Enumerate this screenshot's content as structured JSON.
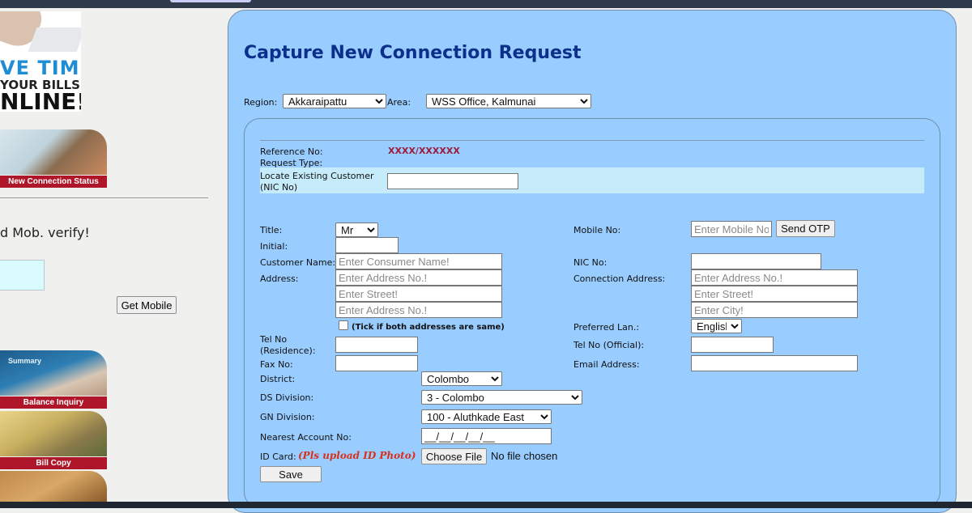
{
  "sidebar": {
    "banner": {
      "line1": "VE TIME",
      "line2": "YOUR BILLS",
      "line3": "NLINE!"
    },
    "tiles": [
      {
        "label": "New Connection Status"
      },
      {
        "label": "Balance Inquiry",
        "sub": "Summary"
      },
      {
        "label": "Bill Copy"
      }
    ],
    "mob_verify_text": "d Mob. verify!",
    "get_mobile_button": "Get Mobile"
  },
  "page": {
    "title": "Capture New Connection Request"
  },
  "filters": {
    "region_label": "Region:",
    "region_value": "Akkaraipattu",
    "area_label": "Area:",
    "area_value": "WSS Office, Kalmunai"
  },
  "form": {
    "reference_label": "Reference No:",
    "reference_value": "XXXX/XXXXXX",
    "request_type_label": "Request Type:",
    "locate_label": "Locate Existing Customer (NIC No)",
    "title_label": "Title:",
    "title_value": "Mr",
    "initial_label": "Initial:",
    "customer_name_label": "Customer Name:",
    "customer_name_placeholder": "Enter Consumer Name!",
    "address_label": "Address:",
    "address_no_placeholder": "Enter Address No.!",
    "address_street_placeholder": "Enter Street!",
    "address_city_placeholder": "Enter Address No.!",
    "same_address_note": "(Tick if both addresses are same)",
    "tel_res_label": "Tel No (Residence):",
    "fax_label": "Fax No:",
    "district_label": "District:",
    "district_value": "Colombo",
    "ds_label": "DS Division:",
    "ds_value": "3 - Colombo",
    "gn_label": "GN Division:",
    "gn_value": "100 - Aluthkade East",
    "nearest_label": "Nearest Account No:",
    "nearest_value": "__/__/__/__/__",
    "idcard_label": "ID Card:",
    "idcard_note": "(Pls upload ID Photo)",
    "choose_file": "Choose File",
    "no_file": "No file chosen",
    "save": "Save",
    "mobile_label": "Mobile No:",
    "mobile_placeholder": "Enter Mobile No",
    "send_otp": "Send OTP",
    "nic_label": "NIC No:",
    "conn_address_label": "Connection Address:",
    "conn_no_placeholder": "Enter Address No.!",
    "conn_street_placeholder": "Enter Street!",
    "conn_city_placeholder": "Enter City!",
    "pref_lang_label": "Preferred Lan.:",
    "pref_lang_value": "English",
    "tel_off_label": "Tel No (Official):",
    "email_label": "Email Address:"
  }
}
